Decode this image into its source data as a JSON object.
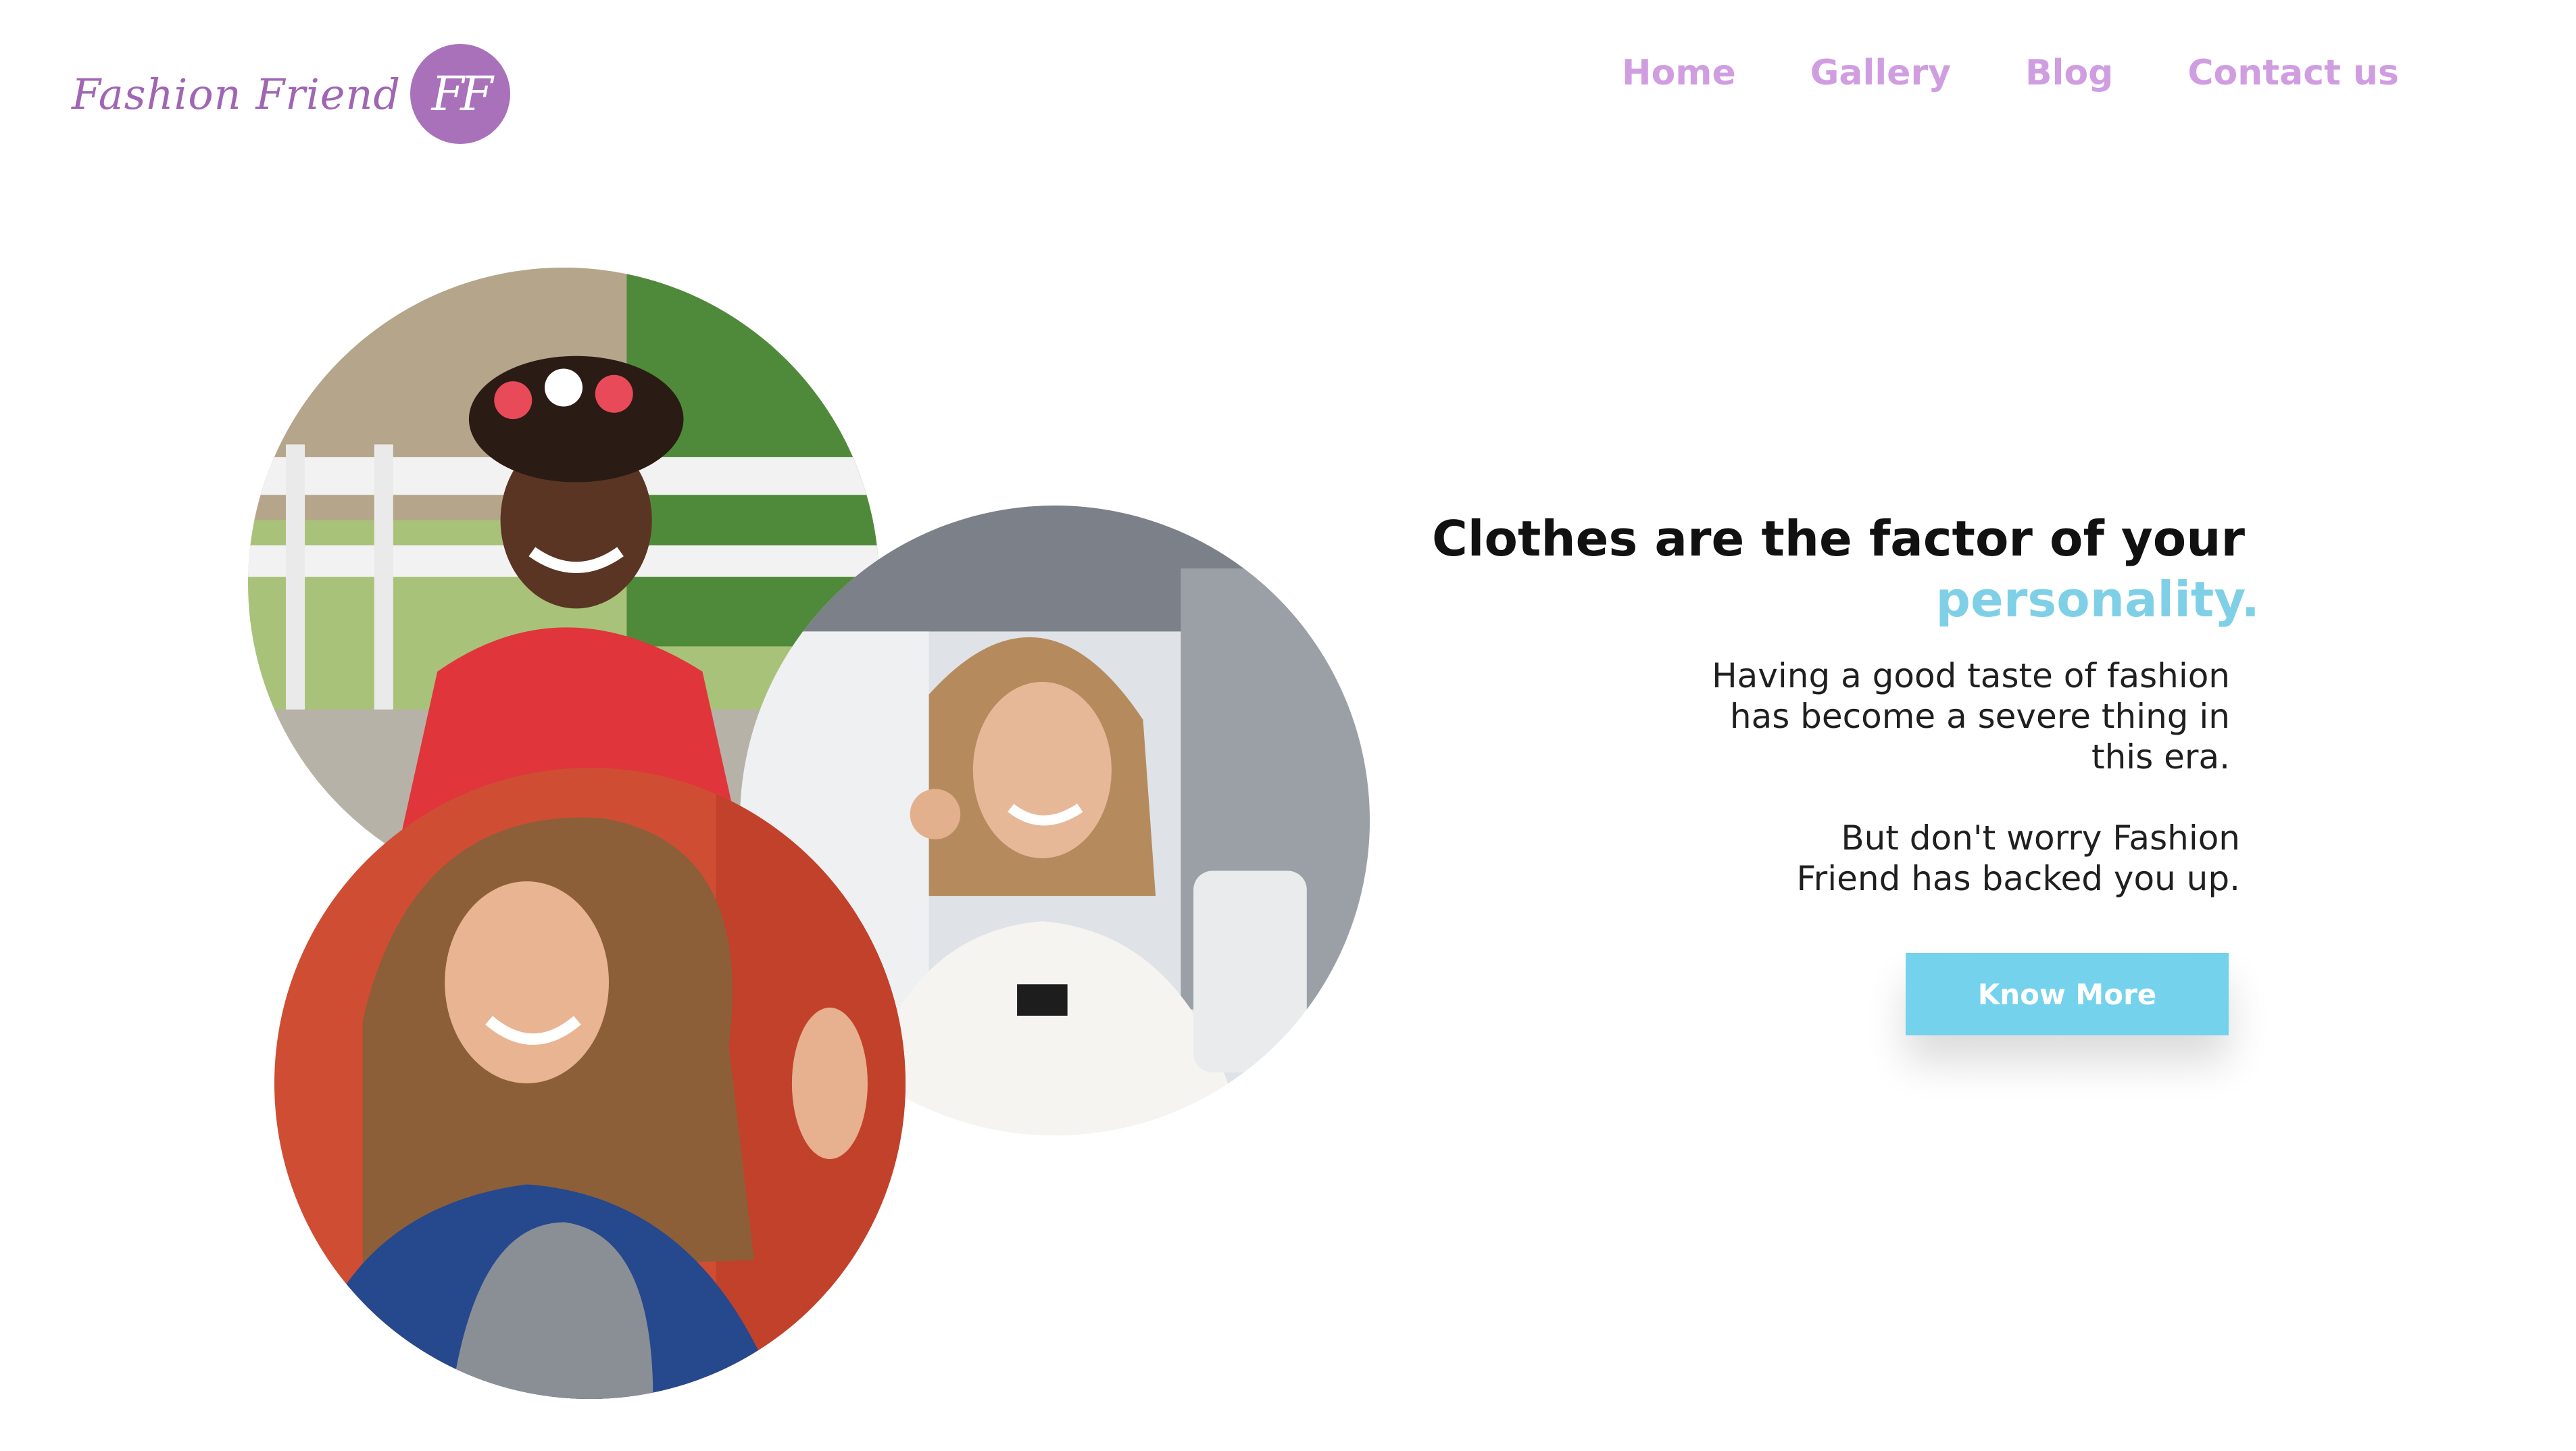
{
  "brand": {
    "name": "Fashion Friend",
    "monogram": "FF",
    "color": "#a871ba"
  },
  "nav": {
    "items": [
      "Home",
      "Gallery",
      "Blog",
      "Contact us"
    ],
    "color": "#d09ee0"
  },
  "hero": {
    "headline_line1": "Clothes are the factor of your",
    "headline_accent": "personality.",
    "accent_color": "#7fd0e6",
    "paragraph_1": "Having a good taste of fashion\nhas become a severe thing in\nthis era.",
    "paragraph_2": "But don't worry Fashion\nFriend has backed you up.",
    "cta_label": "Know More",
    "cta_color": "#74d2ec"
  },
  "photos": [
    "smiling-girl-photo",
    "woman-phone-photo",
    "woman-red-wall-photo"
  ]
}
